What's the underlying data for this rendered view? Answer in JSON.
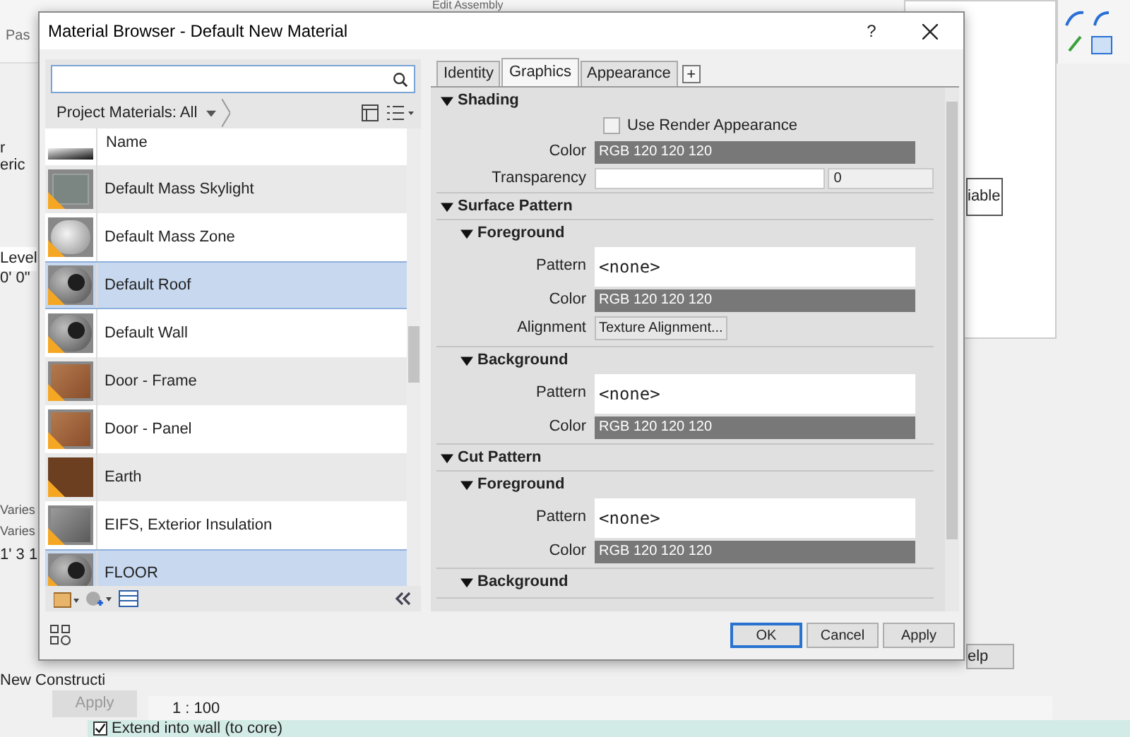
{
  "background": {
    "window_title": "Edit Assembly",
    "ribbon_label": "Pas",
    "left_texts": [
      "r",
      "eric"
    ],
    "level_header": "Level",
    "level_value": "0'  0\"",
    "varies": [
      "Varies",
      "Varies"
    ],
    "dimension": "1'  3 1",
    "phase": "New Constructi",
    "apply_button": "Apply",
    "table_header": "iable",
    "help_button": "elp",
    "scale": "1 : 100",
    "extend_checkbox": {
      "label": "Extend into wall (to core)",
      "checked": true
    }
  },
  "dialog": {
    "title": "Material Browser - Default New Material",
    "help": "?",
    "filter": "Project Materials: All",
    "list_header": "Name",
    "materials": [
      {
        "name": "Default Mass Skylight",
        "kind": "glass",
        "selected": false
      },
      {
        "name": "Default Mass Zone",
        "kind": "zone",
        "selected": false
      },
      {
        "name": "Default Roof",
        "kind": "sphere",
        "selected": true
      },
      {
        "name": "Default Wall",
        "kind": "sphere",
        "selected": false
      },
      {
        "name": "Door - Frame",
        "kind": "wood-box",
        "selected": false
      },
      {
        "name": "Door - Panel",
        "kind": "wood-box",
        "selected": false
      },
      {
        "name": "Earth",
        "kind": "earth",
        "selected": false
      },
      {
        "name": "EIFS, Exterior Insulation",
        "kind": "gray-box",
        "selected": false
      },
      {
        "name": "FLOOR",
        "kind": "sphere",
        "selected": true
      }
    ],
    "tabs": [
      {
        "label": "Identity",
        "selected": false
      },
      {
        "label": "Graphics",
        "selected": true
      },
      {
        "label": "Appearance",
        "selected": false
      }
    ],
    "add_tab": "+",
    "sections": [
      {
        "title": "Shading",
        "expanded": true,
        "fields": [
          {
            "kind": "checkbox",
            "label": "Use Render Appearance",
            "checked": false
          },
          {
            "kind": "color",
            "label": "Color",
            "value": "RGB 120 120 120"
          },
          {
            "kind": "slider",
            "label": "Transparency",
            "level": 0,
            "reading": "0"
          }
        ]
      },
      {
        "title": "Surface Pattern",
        "expanded": true,
        "subsections": [
          {
            "title": "Foreground",
            "expanded": true,
            "fields": [
              {
                "kind": "pattern",
                "label": "Pattern",
                "value": "<none>"
              },
              {
                "kind": "color",
                "label": "Color",
                "value": "RGB 120 120 120"
              },
              {
                "kind": "button",
                "label": "Alignment",
                "value": "Texture Alignment..."
              }
            ]
          },
          {
            "title": "Background",
            "expanded": true,
            "fields": [
              {
                "kind": "pattern",
                "label": "Pattern",
                "value": "<none>"
              },
              {
                "kind": "color",
                "label": "Color",
                "value": "RGB 120 120 120"
              }
            ]
          }
        ]
      },
      {
        "title": "Cut Pattern",
        "expanded": true,
        "subsections": [
          {
            "title": "Foreground",
            "expanded": true,
            "fields": [
              {
                "kind": "pattern",
                "label": "Pattern",
                "value": "<none>"
              },
              {
                "kind": "color",
                "label": "Color",
                "value": "RGB 120 120 120"
              }
            ]
          },
          {
            "title": "Background",
            "expanded": true
          }
        ]
      }
    ],
    "buttons": [
      {
        "label": "OK",
        "default": true
      },
      {
        "label": "Cancel",
        "default": false
      },
      {
        "label": "Apply",
        "default": false
      }
    ]
  }
}
